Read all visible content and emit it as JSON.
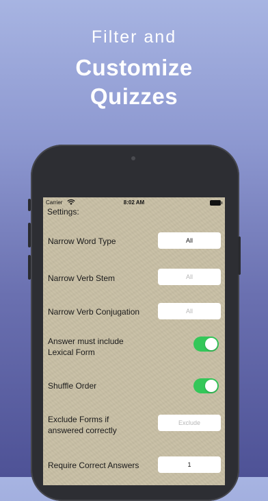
{
  "headline": {
    "subtitle": "Filter and",
    "title_line1": "Customize",
    "title_line2": "Quizzes"
  },
  "status_bar": {
    "carrier": "Carrier",
    "time": "8:02 AM"
  },
  "settings": {
    "heading": "Settings:",
    "narrow_word_type": {
      "label": "Narrow Word Type",
      "value": "All"
    },
    "narrow_verb_stem": {
      "label": "Narrow Verb Stem",
      "placeholder": "All"
    },
    "narrow_verb_conjugation": {
      "label": "Narrow Verb Conjugation",
      "placeholder": "All"
    },
    "answer_lexical": {
      "label_line1": "Answer must include",
      "label_line2": "Lexical Form",
      "on": true
    },
    "shuffle_order": {
      "label": "Shuffle Order",
      "on": true
    },
    "exclude_forms": {
      "label_line1": "Exclude Forms if",
      "label_line2": "answered correctly",
      "placeholder": "Exclude"
    },
    "require_correct": {
      "label": "Require Correct Answers",
      "value": "1"
    }
  },
  "colors": {
    "toggle_on": "#34c759",
    "paper": "#c9c0a6"
  }
}
